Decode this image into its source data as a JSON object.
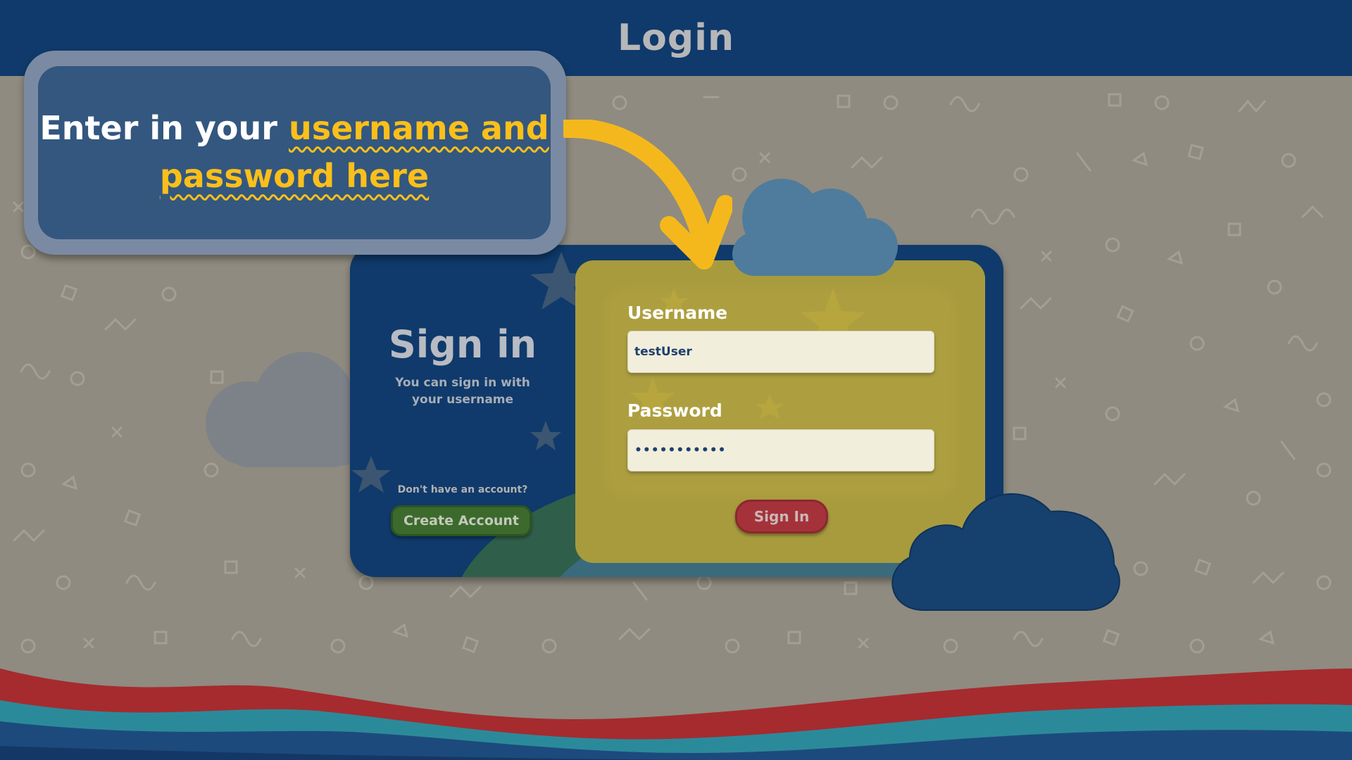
{
  "header": {
    "title": "Login"
  },
  "tutorial": {
    "prefix": "Enter in your ",
    "highlight": "username and password here"
  },
  "card": {
    "heading": "Sign in",
    "subtitle": "You can sign in with your username",
    "no_account": "Don't have an account?",
    "create_account": "Create Account"
  },
  "form": {
    "username_label": "Username",
    "username_value": "testUser",
    "password_label": "Password",
    "password_value": "•••••••••••",
    "signin_label": "Sign In"
  },
  "colors": {
    "header_bg": "#0f3a6b",
    "background": "#8f8b80",
    "accent_yellow": "#fbbf1a",
    "create_button": "#3c6a2c",
    "signin_button": "#a5323a"
  }
}
